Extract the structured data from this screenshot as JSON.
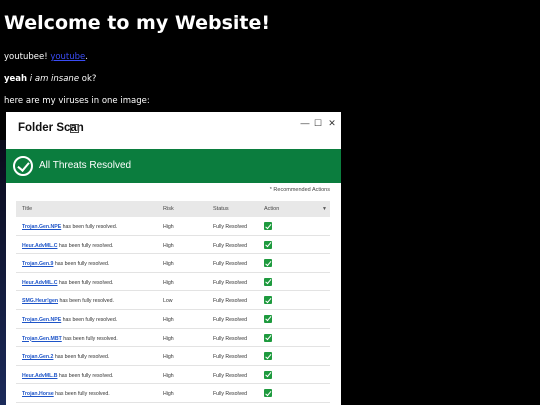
{
  "page": {
    "heading": "Welcome to my Website!",
    "line1": {
      "text": "youtubee! ",
      "link": "youtube",
      "after": "."
    },
    "line2": {
      "bold": "yeah",
      "italic": "i am insane",
      "after": " ok?"
    },
    "line3": "here are my viruses in one image:"
  },
  "window": {
    "title": "Folder Scan",
    "help": "?",
    "controls": {
      "minimize": "—",
      "maximize": "☐",
      "close": "✕"
    },
    "banner": "All Threats Resolved",
    "note": "* Recommended Actions",
    "columns": {
      "title": "Title",
      "risk": "Risk",
      "status": "Status",
      "action": "Action"
    },
    "rows": [
      {
        "threat": "Trojan.Gen.NPE",
        "suffix": " has been fully resolved.",
        "risk": "High",
        "status": "Fully Resolved"
      },
      {
        "threat": "Heur.AdvML.C",
        "suffix": " has been fully resolved.",
        "risk": "High",
        "status": "Fully Resolved"
      },
      {
        "threat": "Trojan.Gen.9",
        "suffix": " has been fully resolved.",
        "risk": "High",
        "status": "Fully Resolved"
      },
      {
        "threat": "Heur.AdvML.C",
        "suffix": " has been fully resolved.",
        "risk": "High",
        "status": "Fully Resolved"
      },
      {
        "threat": "SMG.Heur!gen",
        "suffix": " has been fully resolved.",
        "risk": "Low",
        "status": "Fully Resolved"
      },
      {
        "threat": "Trojan.Gen.NPE",
        "suffix": " has been fully resolved.",
        "risk": "High",
        "status": "Fully Resolved"
      },
      {
        "threat": "Trojan.Gen.MBT",
        "suffix": " has been fully resolved.",
        "risk": "High",
        "status": "Fully Resolved"
      },
      {
        "threat": "Trojan.Gen.2",
        "suffix": " has been fully resolved.",
        "risk": "High",
        "status": "Fully Resolved"
      },
      {
        "threat": "Heur.AdvML.B",
        "suffix": " has been fully resolved.",
        "risk": "High",
        "status": "Fully Resolved"
      },
      {
        "threat": "Trojan.Horse",
        "suffix": " has been fully resolved.",
        "risk": "High",
        "status": "Fully Resolved"
      }
    ]
  },
  "colors": {
    "background": "#000000",
    "banner": "#0b7d3e",
    "link": "#3a4cf5",
    "threat_link": "#1d54c8",
    "action": "#1e9a3e"
  }
}
